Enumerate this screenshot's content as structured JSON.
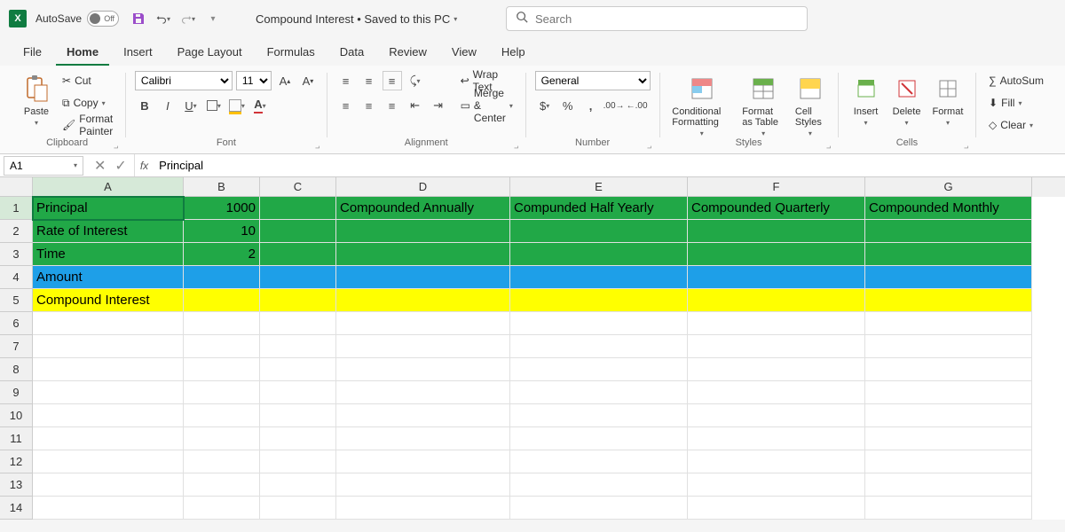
{
  "titlebar": {
    "autosave_label": "AutoSave",
    "autosave_state": "Off",
    "document_title": "Compound Interest • Saved to this PC",
    "search_placeholder": "Search"
  },
  "tabs": [
    "File",
    "Home",
    "Insert",
    "Page Layout",
    "Formulas",
    "Data",
    "Review",
    "View",
    "Help"
  ],
  "active_tab": "Home",
  "ribbon": {
    "clipboard": {
      "paste": "Paste",
      "cut": "Cut",
      "copy": "Copy",
      "format_painter": "Format Painter",
      "label": "Clipboard"
    },
    "font": {
      "name": "Calibri",
      "size": "11",
      "label": "Font"
    },
    "alignment": {
      "wrap": "Wrap Text",
      "merge": "Merge & Center",
      "label": "Alignment"
    },
    "number": {
      "format": "General",
      "label": "Number"
    },
    "styles": {
      "cond": "Conditional Formatting",
      "table": "Format as Table",
      "cell": "Cell Styles",
      "label": "Styles"
    },
    "cells": {
      "insert": "Insert",
      "delete": "Delete",
      "format": "Format",
      "label": "Cells"
    },
    "editing": {
      "autosum": "AutoSum",
      "fill": "Fill",
      "clear": "Clear"
    }
  },
  "formulabar": {
    "name_box": "A1",
    "formula": "Principal"
  },
  "columns": [
    "A",
    "B",
    "C",
    "D",
    "E",
    "F",
    "G"
  ],
  "rows": [
    1,
    2,
    3,
    4,
    5,
    6,
    7,
    8,
    9,
    10,
    11,
    12,
    13,
    14
  ],
  "cells": {
    "A1": "Principal",
    "B1": "1000",
    "D1": "Compounded Annually",
    "E1": "Compunded Half Yearly",
    "F1": "Compounded Quarterly",
    "G1": "Compounded Monthly",
    "A2": "Rate of Interest",
    "B2": "10",
    "A3": "Time",
    "B3": "2",
    "A4": "Amount",
    "A5": "Compound Interest"
  },
  "row_fill": {
    "1": "green",
    "2": "green",
    "3": "green",
    "4": "blue",
    "5": "yellow"
  },
  "active_cell": "A1"
}
